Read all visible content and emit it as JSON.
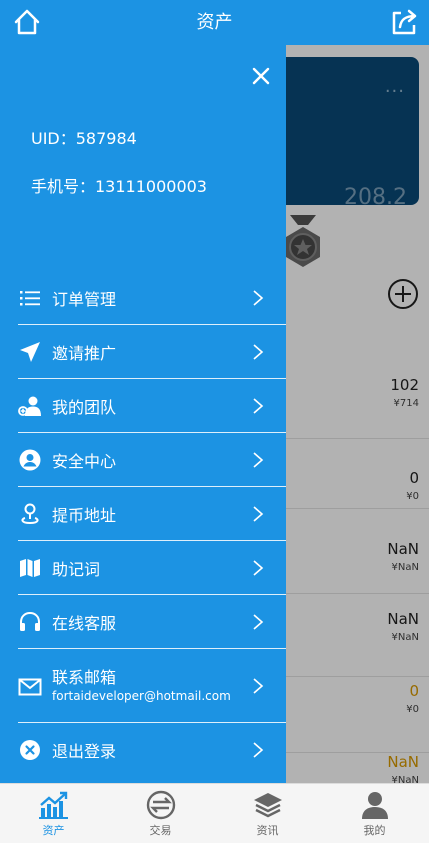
{
  "header": {
    "title": "资产",
    "left_icon": "home-icon",
    "right_icon": "share-icon"
  },
  "background": {
    "card_menu": "···",
    "card_value": "208.2",
    "rows": [
      {
        "amount": "102",
        "sub": "¥714"
      },
      {
        "amount": "0",
        "sub": "¥0"
      },
      {
        "amount": "NaN",
        "sub": "¥NaN"
      },
      {
        "amount": "NaN",
        "sub": "¥NaN"
      },
      {
        "amount": "0",
        "sub": "¥0"
      },
      {
        "amount": "NaN",
        "sub": "¥NaN"
      }
    ]
  },
  "drawer": {
    "uid": "UID：587984",
    "phone": "手机号：13111000003",
    "items": [
      {
        "label": "订单管理",
        "icon": "list-icon"
      },
      {
        "label": "邀请推广",
        "icon": "paper-plane-icon"
      },
      {
        "label": "我的团队",
        "icon": "team-icon"
      },
      {
        "label": "安全中心",
        "icon": "user-circle-icon"
      },
      {
        "label": "提币地址",
        "icon": "location-pin-icon"
      },
      {
        "label": "助记词",
        "icon": "map-icon"
      },
      {
        "label": "在线客服",
        "icon": "headset-icon"
      },
      {
        "label": "联系邮箱",
        "sub": "fortaideveloper@hotmail.com",
        "icon": "envelope-icon"
      },
      {
        "label": "退出登录",
        "icon": "close-circle-icon"
      }
    ]
  },
  "bottom_nav": [
    {
      "label": "资产",
      "icon": "chart-icon",
      "active": true
    },
    {
      "label": "交易",
      "icon": "exchange-icon",
      "active": false
    },
    {
      "label": "资讯",
      "icon": "layers-icon",
      "active": false
    },
    {
      "label": "我的",
      "icon": "person-icon",
      "active": false
    }
  ],
  "colors": {
    "primary": "#1c93e3",
    "card": "#0a4a78",
    "active_tab": "#1c93e3"
  }
}
